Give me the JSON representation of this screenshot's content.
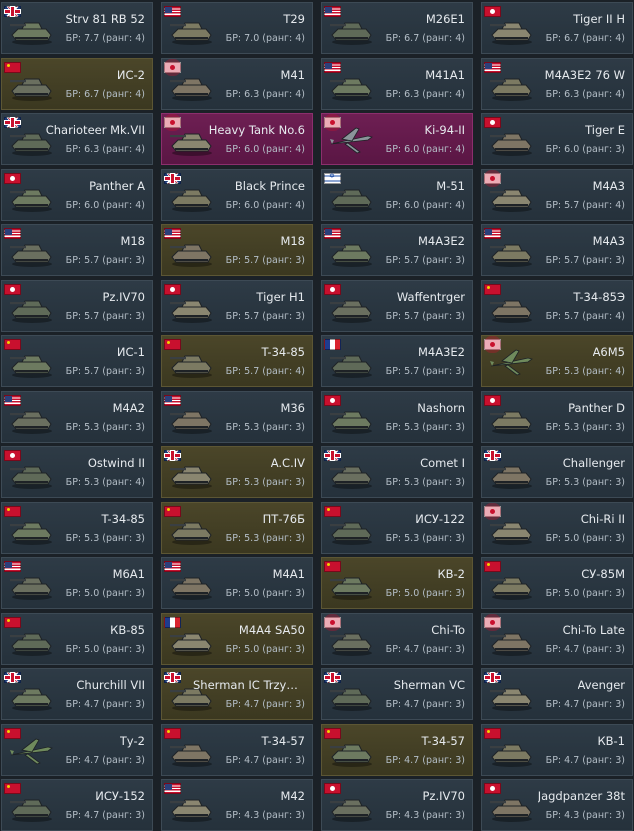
{
  "vehicles": [
    {
      "name": "Strv 81 RB 52",
      "br": "БР: 7.7 (ранг: 4)",
      "nation": "uk",
      "type": "tank",
      "tier": "normal"
    },
    {
      "name": "T29",
      "br": "БР: 7.0 (ранг: 4)",
      "nation": "us",
      "type": "tank",
      "tier": "normal"
    },
    {
      "name": "M26E1",
      "br": "БР: 6.7 (ранг: 4)",
      "nation": "us",
      "type": "tank",
      "tier": "normal"
    },
    {
      "name": "Tiger II H",
      "br": "БР: 6.7 (ранг: 4)",
      "nation": "de",
      "type": "tank",
      "tier": "normal"
    },
    {
      "name": "ИС-2",
      "br": "БР: 6.7 (ранг: 4)",
      "nation": "ussr",
      "type": "tank",
      "tier": "premium"
    },
    {
      "name": "M41",
      "br": "БР: 6.3 (ранг: 4)",
      "nation": "jp",
      "type": "tank",
      "tier": "normal"
    },
    {
      "name": "M41A1",
      "br": "БР: 6.3 (ранг: 4)",
      "nation": "us",
      "type": "tank",
      "tier": "normal"
    },
    {
      "name": "M4A3E2 76 W",
      "br": "БР: 6.3 (ранг: 4)",
      "nation": "us",
      "type": "tank",
      "tier": "normal"
    },
    {
      "name": "Charioteer Mk.VII",
      "br": "БР: 6.3 (ранг: 4)",
      "nation": "uk",
      "type": "tank",
      "tier": "normal"
    },
    {
      "name": "Heavy Tank No.6",
      "br": "БР: 6.0 (ранг: 4)",
      "nation": "jp",
      "type": "tank",
      "tier": "squadron"
    },
    {
      "name": "Ki-94-II",
      "br": "БР: 6.0 (ранг: 4)",
      "nation": "jp",
      "type": "plane",
      "tier": "squadron"
    },
    {
      "name": "Tiger E",
      "br": "БР: 6.0 (ранг: 3)",
      "nation": "de",
      "type": "tank",
      "tier": "normal"
    },
    {
      "name": "Panther A",
      "br": "БР: 6.0 (ранг: 4)",
      "nation": "de",
      "type": "tank",
      "tier": "normal"
    },
    {
      "name": "Black Prince",
      "br": "БР: 6.0 (ранг: 4)",
      "nation": "uk",
      "type": "tank",
      "tier": "normal"
    },
    {
      "name": "M-51",
      "br": "БР: 6.0 (ранг: 4)",
      "nation": "il",
      "type": "tank",
      "tier": "normal"
    },
    {
      "name": "M4A3",
      "br": "БР: 5.7 (ранг: 4)",
      "nation": "jp",
      "type": "tank",
      "tier": "normal"
    },
    {
      "name": "M18",
      "br": "БР: 5.7 (ранг: 3)",
      "nation": "us",
      "type": "tank",
      "tier": "normal"
    },
    {
      "name": "M18",
      "br": "БР: 5.7 (ранг: 3)",
      "nation": "us",
      "type": "tank",
      "tier": "premium"
    },
    {
      "name": "M4A3E2",
      "br": "БР: 5.7 (ранг: 3)",
      "nation": "us",
      "type": "tank",
      "tier": "normal"
    },
    {
      "name": "M4A3",
      "br": "БР: 5.7 (ранг: 3)",
      "nation": "us",
      "type": "tank",
      "tier": "normal"
    },
    {
      "name": "Pz.IV70",
      "br": "БР: 5.7 (ранг: 3)",
      "nation": "de",
      "type": "tank",
      "tier": "normal"
    },
    {
      "name": "Tiger H1",
      "br": "БР: 5.7 (ранг: 3)",
      "nation": "de",
      "type": "tank",
      "tier": "normal"
    },
    {
      "name": "Waffentrger",
      "br": "БР: 5.7 (ранг: 3)",
      "nation": "de",
      "type": "tank",
      "tier": "normal"
    },
    {
      "name": "T-34-85Э",
      "br": "БР: 5.7 (ранг: 4)",
      "nation": "ussr",
      "type": "tank",
      "tier": "normal"
    },
    {
      "name": "ИС-1",
      "br": "БР: 5.7 (ранг: 3)",
      "nation": "ussr",
      "type": "tank",
      "tier": "normal"
    },
    {
      "name": "T-34-85",
      "br": "БР: 5.7 (ранг: 4)",
      "nation": "ussr",
      "type": "tank",
      "tier": "premium"
    },
    {
      "name": "M4A3E2",
      "br": "БР: 5.7 (ранг: 3)",
      "nation": "fr",
      "type": "tank",
      "tier": "normal"
    },
    {
      "name": "A6M5",
      "br": "БР: 5.3 (ранг: 4)",
      "nation": "jp",
      "type": "plane",
      "tier": "premium"
    },
    {
      "name": "M4A2",
      "br": "БР: 5.3 (ранг: 3)",
      "nation": "us",
      "type": "tank",
      "tier": "normal"
    },
    {
      "name": "M36",
      "br": "БР: 5.3 (ранг: 3)",
      "nation": "us",
      "type": "tank",
      "tier": "normal"
    },
    {
      "name": "Nashorn",
      "br": "БР: 5.3 (ранг: 3)",
      "nation": "de",
      "type": "tank",
      "tier": "normal"
    },
    {
      "name": "Panther D",
      "br": "БР: 5.3 (ранг: 3)",
      "nation": "de",
      "type": "tank",
      "tier": "normal"
    },
    {
      "name": "Ostwind II",
      "br": "БР: 5.3 (ранг: 4)",
      "nation": "de",
      "type": "tank",
      "tier": "normal"
    },
    {
      "name": "A.C.IV",
      "br": "БР: 5.3 (ранг: 3)",
      "nation": "uk",
      "type": "tank",
      "tier": "premium"
    },
    {
      "name": "Comet I",
      "br": "БР: 5.3 (ранг: 3)",
      "nation": "uk",
      "type": "tank",
      "tier": "normal"
    },
    {
      "name": "Challenger",
      "br": "БР: 5.3 (ранг: 3)",
      "nation": "uk",
      "type": "tank",
      "tier": "normal"
    },
    {
      "name": "T-34-85",
      "br": "БР: 5.3 (ранг: 3)",
      "nation": "ussr",
      "type": "tank",
      "tier": "normal"
    },
    {
      "name": "ПТ-76Б",
      "br": "БР: 5.3 (ранг: 3)",
      "nation": "ussr",
      "type": "tank",
      "tier": "premium"
    },
    {
      "name": "ИСУ-122",
      "br": "БР: 5.3 (ранг: 3)",
      "nation": "ussr",
      "type": "tank",
      "tier": "normal"
    },
    {
      "name": "Chi-Ri II",
      "br": "БР: 5.0 (ранг: 3)",
      "nation": "jp",
      "type": "tank",
      "tier": "normal"
    },
    {
      "name": "M6A1",
      "br": "БР: 5.0 (ранг: 3)",
      "nation": "us",
      "type": "tank",
      "tier": "normal"
    },
    {
      "name": "M4A1",
      "br": "БР: 5.0 (ранг: 3)",
      "nation": "us",
      "type": "tank",
      "tier": "normal"
    },
    {
      "name": "КВ-2",
      "br": "БР: 5.0 (ранг: 3)",
      "nation": "ussr",
      "type": "tank",
      "tier": "premium"
    },
    {
      "name": "СУ-85М",
      "br": "БР: 5.0 (ранг: 3)",
      "nation": "ussr",
      "type": "tank",
      "tier": "normal"
    },
    {
      "name": "КВ-85",
      "br": "БР: 5.0 (ранг: 3)",
      "nation": "ussr",
      "type": "tank",
      "tier": "normal"
    },
    {
      "name": "M4A4 SA50",
      "br": "БР: 5.0 (ранг: 3)",
      "nation": "fr",
      "type": "tank",
      "tier": "premium"
    },
    {
      "name": "Chi-To",
      "br": "БР: 4.7 (ранг: 3)",
      "nation": "jp",
      "type": "tank",
      "tier": "normal"
    },
    {
      "name": "Chi-To Late",
      "br": "БР: 4.7 (ранг: 3)",
      "nation": "jp",
      "type": "tank",
      "tier": "normal"
    },
    {
      "name": "Churchill VII",
      "br": "БР: 4.7 (ранг: 3)",
      "nation": "uk",
      "type": "tank",
      "tier": "normal"
    },
    {
      "name": "Sherman IC Trzyni...",
      "br": "БР: 4.7 (ранг: 3)",
      "nation": "uk",
      "type": "tank",
      "tier": "premium"
    },
    {
      "name": "Sherman VC",
      "br": "БР: 4.7 (ранг: 3)",
      "nation": "uk",
      "type": "tank",
      "tier": "normal"
    },
    {
      "name": "Avenger",
      "br": "БР: 4.7 (ранг: 3)",
      "nation": "uk",
      "type": "tank",
      "tier": "normal"
    },
    {
      "name": "Ту-2",
      "br": "БР: 4.7 (ранг: 3)",
      "nation": "ussr",
      "type": "plane",
      "tier": "normal"
    },
    {
      "name": "T-34-57",
      "br": "БР: 4.7 (ранг: 3)",
      "nation": "ussr",
      "type": "tank",
      "tier": "normal"
    },
    {
      "name": "T-34-57",
      "br": "БР: 4.7 (ранг: 3)",
      "nation": "ussr",
      "type": "tank",
      "tier": "premium"
    },
    {
      "name": "КВ-1",
      "br": "БР: 4.7 (ранг: 3)",
      "nation": "ussr",
      "type": "tank",
      "tier": "normal"
    },
    {
      "name": "ИСУ-152",
      "br": "БР: 4.7 (ранг: 3)",
      "nation": "ussr",
      "type": "tank",
      "tier": "normal"
    },
    {
      "name": "M42",
      "br": "БР: 4.3 (ранг: 3)",
      "nation": "us",
      "type": "tank",
      "tier": "normal"
    },
    {
      "name": "Pz.IV70",
      "br": "БР: 4.3 (ранг: 3)",
      "nation": "de",
      "type": "tank",
      "tier": "normal"
    },
    {
      "name": "Jagdpanzer 38t",
      "br": "БР: 4.3 (ранг: 3)",
      "nation": "de",
      "type": "tank",
      "tier": "normal"
    }
  ],
  "colors": {
    "card_normal": "#2b3742",
    "card_premium": "#433f25",
    "card_squadron": "#661b4c",
    "text": "#e6eaee",
    "subtext": "#b5bfc8"
  },
  "icons": {
    "tank": "tank-icon",
    "plane": "plane-icon"
  }
}
